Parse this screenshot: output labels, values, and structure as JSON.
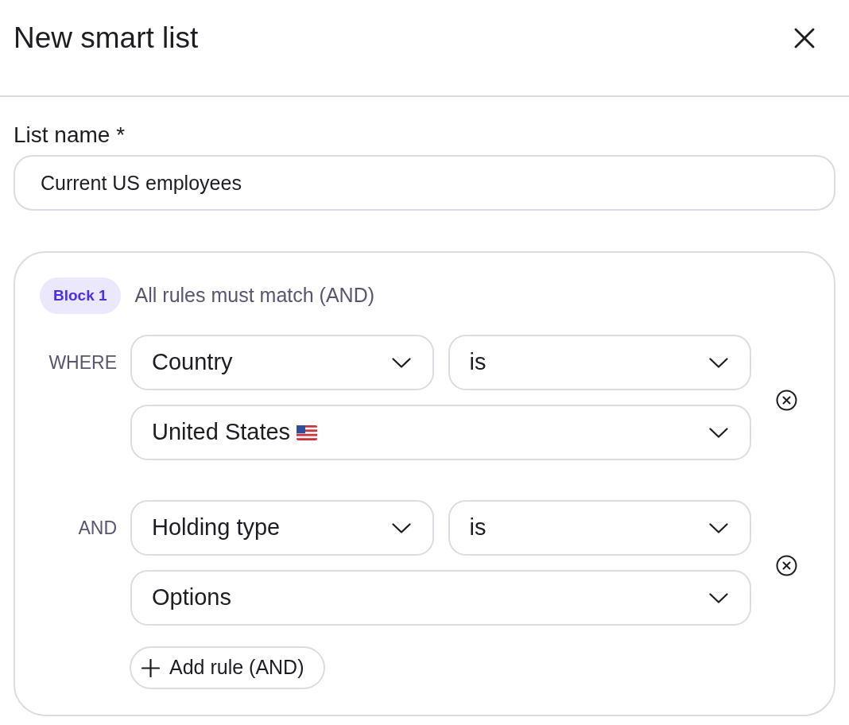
{
  "dialog": {
    "title": "New smart list"
  },
  "list_name": {
    "label": "List name *",
    "value": "Current US employees"
  },
  "block": {
    "badge": "Block 1",
    "description": "All rules must match (AND)",
    "rules": [
      {
        "connector": "WHERE",
        "field": "Country",
        "operator": "is",
        "value": "United States",
        "flag": true
      },
      {
        "connector": "AND",
        "field": "Holding type",
        "operator": "is",
        "value": "Options",
        "flag": false
      }
    ],
    "add_button": "Add rule (AND)"
  }
}
